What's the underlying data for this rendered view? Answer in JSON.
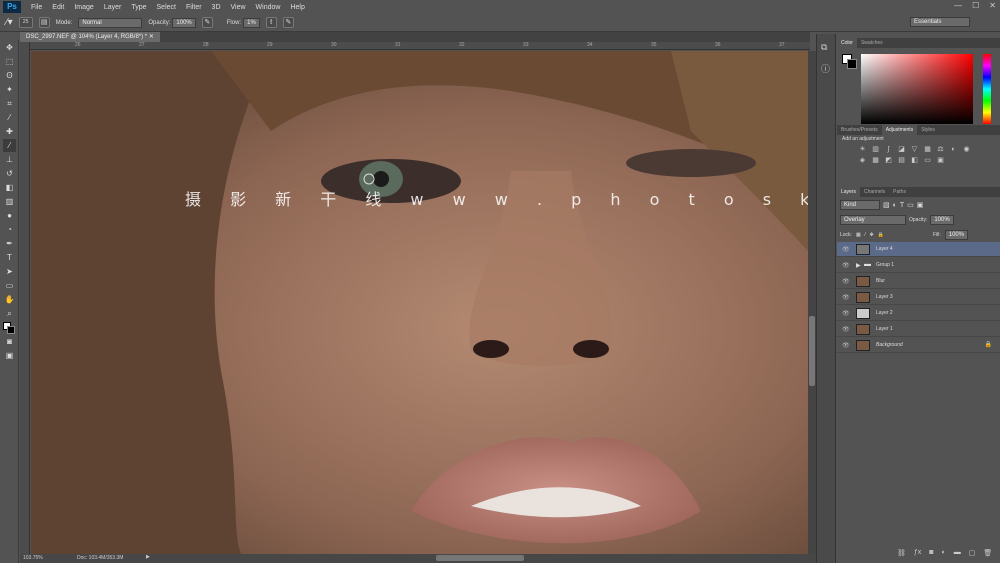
{
  "app": {
    "logo": "Ps",
    "menu": [
      "File",
      "Edit",
      "Image",
      "Layer",
      "Type",
      "Select",
      "Filter",
      "3D",
      "View",
      "Window",
      "Help"
    ]
  },
  "options": {
    "brush_size": "25",
    "mode_label": "Mode:",
    "mode_value": "Normal",
    "opacity_label": "Opacity:",
    "opacity_value": "100%",
    "flow_label": "Flow:",
    "flow_value": "1%",
    "workspace": "Essentials"
  },
  "document": {
    "tab_title": "DSC_2997.NEF @ 104% (Layer 4, RGB/8*) *",
    "ruler_top": [
      "26",
      "27",
      "28",
      "29",
      "30",
      "31",
      "32",
      "33",
      "34",
      "35",
      "36",
      "37",
      "38"
    ]
  },
  "watermark": "摄 影 新 干 线   w w w . p h o t o s k s . v i p",
  "status": {
    "zoom": "103.75%",
    "doc": "Doc: 103.4M/353.3M"
  },
  "color_panel": {
    "tabs": [
      "Color",
      "Swatches"
    ]
  },
  "adjustments_panel": {
    "tabs": [
      "Brushes/Presets",
      "Adjustments",
      "Styles"
    ],
    "subtitle": "Add an adjustment"
  },
  "layers_panel": {
    "tabs": [
      "Layers",
      "Channels",
      "Paths"
    ],
    "kind": "Kind",
    "blend": "Overlay",
    "opacity_label": "Opacity:",
    "opacity_value": "100%",
    "lock_label": "Lock:",
    "fill_label": "Fill:",
    "fill_value": "100%",
    "layers": [
      {
        "name": "Layer 4"
      },
      {
        "name": "Group 1"
      },
      {
        "name": "Blur"
      },
      {
        "name": "Layer 3"
      },
      {
        "name": "Layer 2"
      },
      {
        "name": "Layer 1"
      },
      {
        "name": "Background"
      }
    ]
  }
}
